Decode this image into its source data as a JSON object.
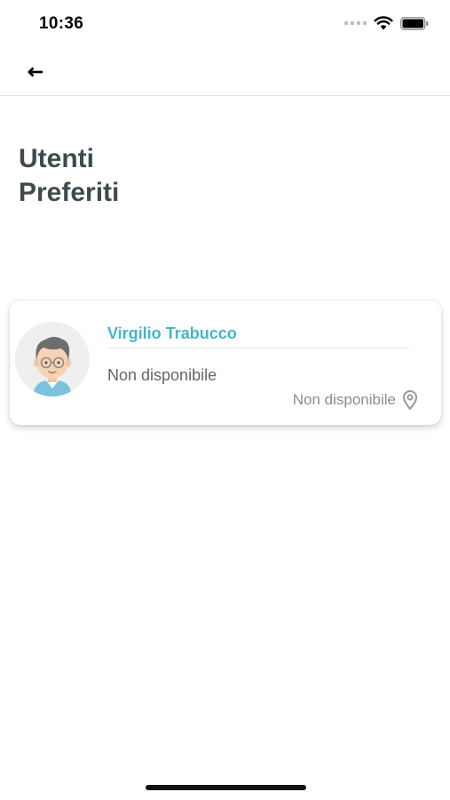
{
  "status_bar": {
    "time": "10:36"
  },
  "page": {
    "title_line1": "Utenti",
    "title_line2": "Preferiti"
  },
  "favorites": [
    {
      "name": "Virgilio Trabucco",
      "status": "Non disponibile",
      "location": "Non disponibile"
    }
  ],
  "colors": {
    "accent": "#3fb8c6",
    "title": "#3e4a4f",
    "muted": "#8d8d8d"
  },
  "icons": [
    "back-arrow-icon",
    "wifi-icon",
    "battery-icon",
    "location-pin-icon"
  ]
}
